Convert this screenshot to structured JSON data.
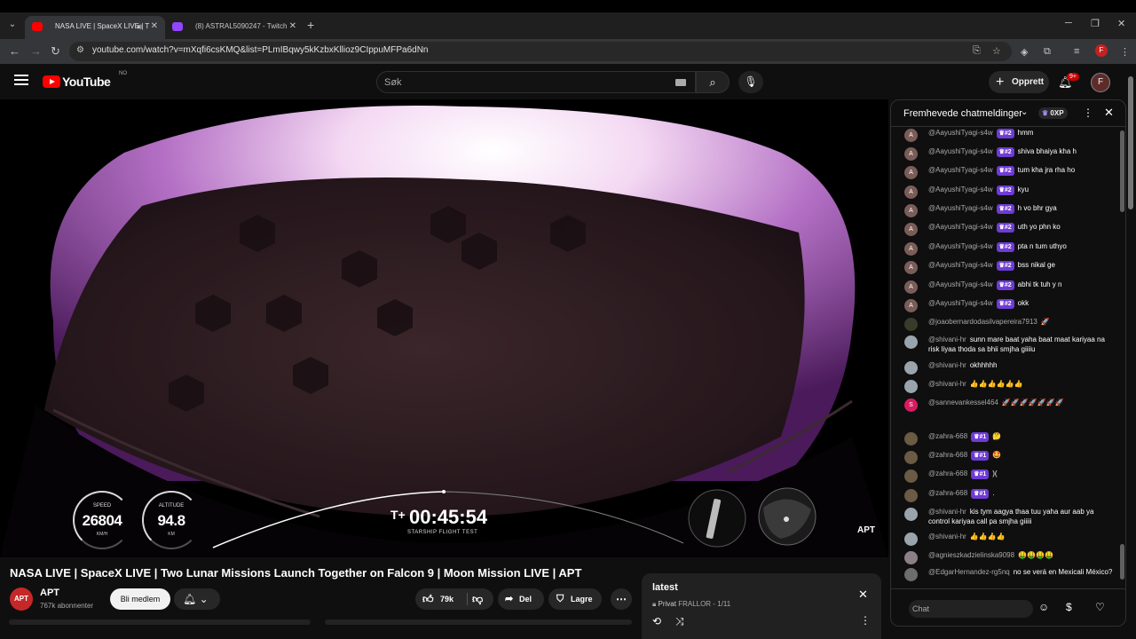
{
  "browser": {
    "tabs": [
      {
        "title": "NASA LIVE | SpaceX LIVE | T",
        "active": true,
        "favicon_color": "#ff0000"
      },
      {
        "title": "(8) ASTRAL5090247 - Twitch",
        "active": false,
        "favicon_color": "#9146ff"
      }
    ],
    "url": "youtube.com/watch?v=mXqfi6csKMQ&list=PLmIBqwy5kKzbxKllioz9CIppuMFPa6dNn",
    "profile_initial": "F"
  },
  "youtube": {
    "logo_text": "YouTube",
    "region": "NO",
    "search_placeholder": "Søk",
    "create_label": "Opprett",
    "notif_count": "9+",
    "account_initial": "F"
  },
  "video": {
    "hud": {
      "speed_label": "SPEED",
      "speed_value": "26804",
      "speed_unit": "KM/H",
      "altitude_label": "ALTITUDE",
      "altitude_value": "94.8",
      "altitude_unit": "KM",
      "t_prefix": "T+",
      "clock": "00:45:54",
      "mission": "STARSHIP FLIGHT TEST"
    },
    "watermark": "APT",
    "title": "NASA LIVE | SpaceX LIVE | Two Lunar Missions Launch Together on Falcon 9 | Moon Mission LIVE | APT",
    "channel": "APT",
    "channel_logo": "APT",
    "subscribers": "767k abonnenter",
    "join_label": "Bli medlem",
    "likes": "79k",
    "share_label": "Del",
    "save_label": "Lagre"
  },
  "playlist": {
    "title": "latest",
    "privacy": "Privat",
    "meta": "FRALLOR - 1/11"
  },
  "chat": {
    "header": "Fremhevede chatmeldinger",
    "points": "0XP",
    "input_placeholder": "Chat",
    "messages": [
      {
        "author": "@AayushiTyagi-s4w",
        "badge": "#2",
        "text": "hmm",
        "avatar": "A",
        "avatar_color": "#7a5c58"
      },
      {
        "author": "@AayushiTyagi-s4w",
        "badge": "#2",
        "text": "shiva bhaiya kha h",
        "avatar": "A",
        "avatar_color": "#7a5c58"
      },
      {
        "author": "@AayushiTyagi-s4w",
        "badge": "#2",
        "text": "tum kha jra rha ho",
        "avatar": "A",
        "avatar_color": "#7a5c58"
      },
      {
        "author": "@AayushiTyagi-s4w",
        "badge": "#2",
        "text": "kyu",
        "avatar": "A",
        "avatar_color": "#7a5c58"
      },
      {
        "author": "@AayushiTyagi-s4w",
        "badge": "#2",
        "text": "h vo bhr gya",
        "avatar": "A",
        "avatar_color": "#7a5c58"
      },
      {
        "author": "@AayushiTyagi-s4w",
        "badge": "#2",
        "text": "uth yo phn ko",
        "avatar": "A",
        "avatar_color": "#7a5c58"
      },
      {
        "author": "@AayushiTyagi-s4w",
        "badge": "#2",
        "text": "pta n tum uthyo",
        "avatar": "A",
        "avatar_color": "#7a5c58"
      },
      {
        "author": "@AayushiTyagi-s4w",
        "badge": "#2",
        "text": "bss nikal ge",
        "avatar": "A",
        "avatar_color": "#7a5c58"
      },
      {
        "author": "@AayushiTyagi-s4w",
        "badge": "#2",
        "text": "abhi tk tuh y n",
        "avatar": "A",
        "avatar_color": "#7a5c58"
      },
      {
        "author": "@AayushiTyagi-s4w",
        "badge": "#2",
        "text": "okk",
        "avatar": "A",
        "avatar_color": "#7a5c58"
      },
      {
        "author": "@joaobernardodasilvapereira7913",
        "badge": "",
        "text": "🚀",
        "avatar": "",
        "avatar_color": "#3a3a2a"
      },
      {
        "author": "@shivani-hr",
        "badge": "",
        "text": "sunn mare baat yaha baat maat kariyaa na risk liyaa thoda sa bhii smjha giiiiu",
        "avatar": "",
        "avatar_color": "#9aa4ad"
      },
      {
        "author": "@shivani-hr",
        "badge": "",
        "text": "okhhhhh",
        "avatar": "",
        "avatar_color": "#9aa4ad"
      },
      {
        "author": "@shivani-hr",
        "badge": "",
        "text": "👍👍👍👍👍👍",
        "avatar": "",
        "avatar_color": "#9aa4ad"
      },
      {
        "author": "@sannevankessel464",
        "badge": "",
        "text": "🚀🚀🚀🚀🚀🚀🚀",
        "avatar": "S",
        "avatar_color": "#d81b60"
      },
      {
        "author": "@zahra-668",
        "badge": "#1",
        "text": "🤔",
        "avatar": "",
        "avatar_color": "#6b5a44"
      },
      {
        "author": "@zahra-668",
        "badge": "#1",
        "text": "🤩",
        "avatar": "",
        "avatar_color": "#6b5a44"
      },
      {
        "author": "@zahra-668",
        "badge": "#1",
        "text": ")(",
        "avatar": "",
        "avatar_color": "#6b5a44"
      },
      {
        "author": "@zahra-668",
        "badge": "#1",
        "text": ".",
        "avatar": "",
        "avatar_color": "#6b5a44"
      },
      {
        "author": "@shivani-hr",
        "badge": "",
        "text": "kis tym aagya thaa tuu yaha aur aab ya control kariyaa call pa smjha giiiii",
        "avatar": "",
        "avatar_color": "#9aa4ad"
      },
      {
        "author": "@shivani-hr",
        "badge": "",
        "text": "👍👍👍👍",
        "avatar": "",
        "avatar_color": "#9aa4ad"
      },
      {
        "author": "@agnieszkadzielinska9098",
        "badge": "",
        "text": "🤑🤑🤑🤑",
        "avatar": "",
        "avatar_color": "#8c7f86"
      },
      {
        "author": "@EdgarHernandez-rg5nq",
        "badge": "",
        "text": "no se verá en Mexicali México?",
        "avatar": "",
        "avatar_color": "#6d6d6d"
      }
    ]
  }
}
